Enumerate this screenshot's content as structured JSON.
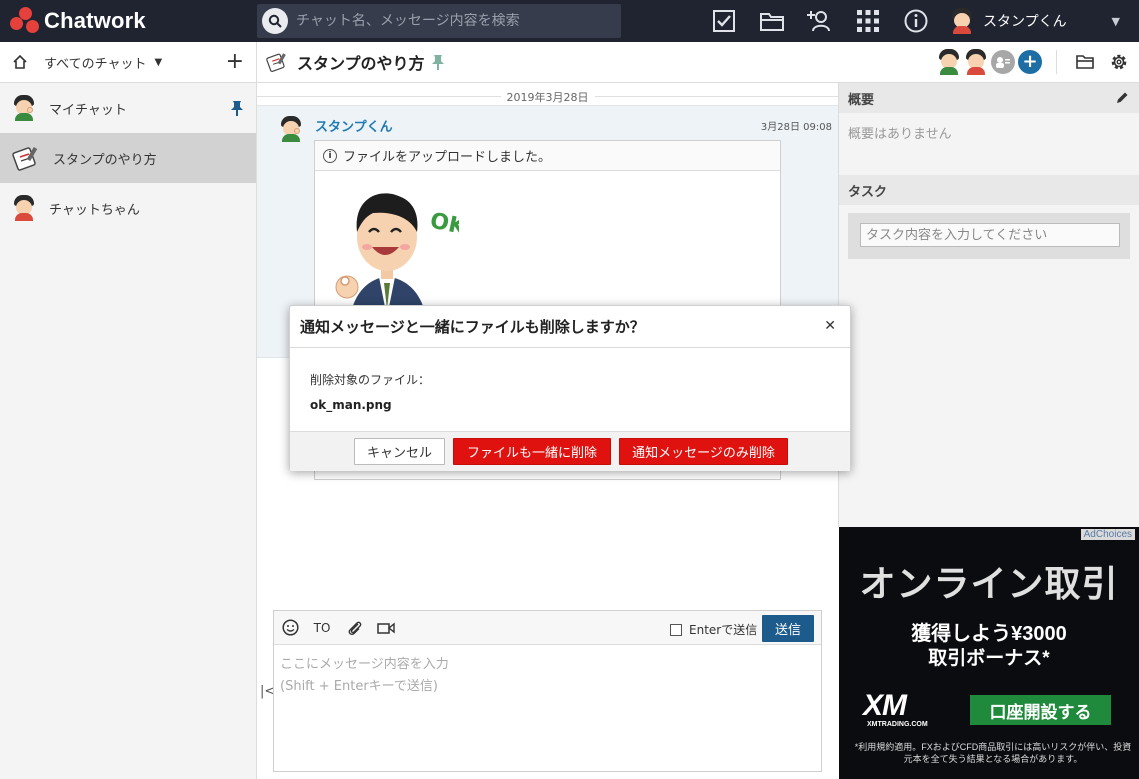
{
  "app": {
    "name": "Chatwork"
  },
  "search": {
    "placeholder": "チャット名、メッセージ内容を検索"
  },
  "user": {
    "name": "スタンプくん"
  },
  "top_icons": [
    "task-check-icon",
    "folder-icon",
    "add-contact-icon",
    "apps-grid-icon",
    "info-icon"
  ],
  "sidebar": {
    "filter_label": "すべてのチャット",
    "rooms": [
      {
        "name": "マイチャット",
        "pinned": true
      },
      {
        "name": "スタンプのやり方",
        "active": true
      },
      {
        "name": "チャットちゃん"
      }
    ]
  },
  "chat": {
    "title": "スタンプのやり方",
    "date": "2019年3月28日",
    "message": {
      "sender": "スタンプくん",
      "time": "3月28日 09:08",
      "file_notice": "ファイルをアップロードしました。",
      "image_text": "OK!"
    }
  },
  "composer": {
    "to_label": "TO",
    "enter_label": "Enterで送信",
    "send_label": "送信",
    "placeholder_line1": "ここにメッセージ内容を入力",
    "placeholder_line2": "(Shift + Enterキーで送信)"
  },
  "right_panel": {
    "summary_title": "概要",
    "summary_text": "概要はありません",
    "task_title": "タスク",
    "task_placeholder": "タスク内容を入力してください"
  },
  "ad": {
    "adchoices": "AdChoices",
    "title": "オンライン取引",
    "line1": "獲得しよう¥3000",
    "line2": "取引ボーナス*",
    "logo": "XM",
    "logo_sub": "XMTRADING.COM",
    "cta": "口座開設する",
    "footnote": "*利用規約適用。FXおよびCFD商品取引には高いリスクが伴い、投資元本を全て失う結果となる場合があります。"
  },
  "modal": {
    "title": "通知メッセージと一緒にファイルも削除しますか？",
    "label": "削除対象のファイル：",
    "filename": "ok_man.png",
    "cancel": "キャンセル",
    "delete_with_file": "ファイルも一緒に削除",
    "delete_notice_only": "通知メッセージのみ削除"
  },
  "colors": {
    "topbar": "#1f2430",
    "accent": "#1c5b8c",
    "danger": "#e0120f",
    "brand": "#e5403b"
  }
}
